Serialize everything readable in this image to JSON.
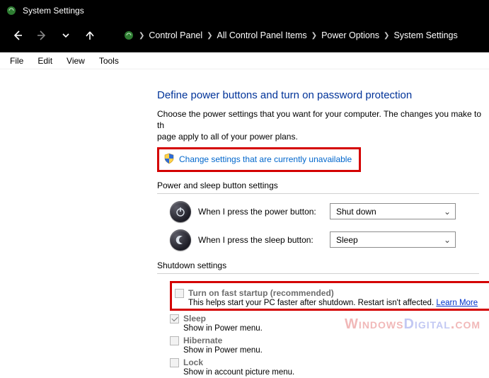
{
  "titlebar": {
    "title": "System Settings"
  },
  "breadcrumbs": {
    "items": [
      "Control Panel",
      "All Control Panel Items",
      "Power Options",
      "System Settings"
    ]
  },
  "menubar": {
    "items": [
      "File",
      "Edit",
      "View",
      "Tools"
    ]
  },
  "page": {
    "title": "Define power buttons and turn on password protection",
    "desc_line1": "Choose the power settings that you want for your computer. The changes you make to th",
    "desc_line2": "page apply to all of your power plans.",
    "change_link": "Change settings that are currently unavailable"
  },
  "power_section": {
    "legend": "Power and sleep button settings",
    "rows": [
      {
        "label": "When I press the power button:",
        "value": "Shut down"
      },
      {
        "label": "When I press the sleep button:",
        "value": "Sleep"
      }
    ]
  },
  "shutdown_section": {
    "legend": "Shutdown settings",
    "fast_startup": {
      "title": "Turn on fast startup (recommended)",
      "desc": "This helps start your PC faster after shutdown. Restart isn't affected. ",
      "learn_more": "Learn More"
    },
    "sleep": {
      "title": "Sleep",
      "desc": "Show in Power menu."
    },
    "hibernate": {
      "title": "Hibernate",
      "desc": "Show in Power menu."
    },
    "lock": {
      "title": "Lock",
      "desc": "Show in account picture menu."
    }
  },
  "watermark": {
    "a": "Windows",
    "b": "Digital",
    "c": ".com"
  }
}
